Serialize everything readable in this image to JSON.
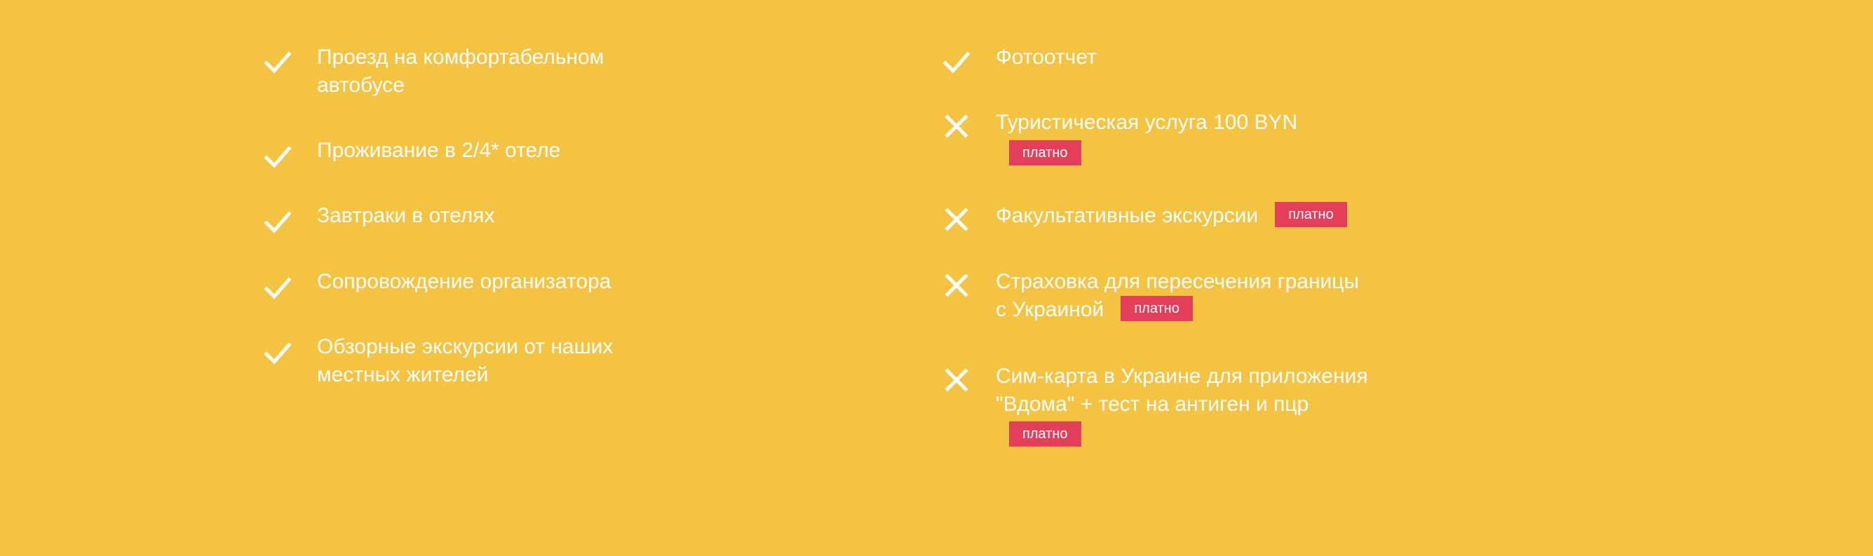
{
  "colors": {
    "background": "#F4C342",
    "badge": "#E43F5A",
    "text": "#FFFFFF"
  },
  "included": [
    {
      "icon": "check-icon",
      "lines": [
        "Проезд на комфортабельном",
        "автобусе"
      ]
    },
    {
      "icon": "check-icon",
      "lines": [
        "Проживание в 2/4* отеле"
      ]
    },
    {
      "icon": "check-icon",
      "lines": [
        "Завтраки в отелях"
      ]
    },
    {
      "icon": "check-icon",
      "lines": [
        "Сопровождение организатора"
      ]
    },
    {
      "icon": "check-icon",
      "lines": [
        "Обзорные экскурсии от наших",
        "местных жителей"
      ]
    }
  ],
  "extras": [
    {
      "icon": "check-icon",
      "lines": [
        "Фотоотчет"
      ]
    },
    {
      "icon": "cross-icon",
      "lines": [
        "Туристическая услуга 100 BYN"
      ],
      "badge": "платно"
    },
    {
      "icon": "cross-icon",
      "lines": [
        "Факультативные экскурсии"
      ],
      "badge": "платно"
    },
    {
      "icon": "cross-icon",
      "lines": [
        "Страховка для пересечения границы",
        "с Украиной"
      ],
      "badge": "платно"
    },
    {
      "icon": "cross-icon",
      "lines": [
        "Сим-карта в Украине для приложения",
        "\"Вдома\" + тест на антиген и пцр"
      ],
      "badge": "платно"
    }
  ]
}
